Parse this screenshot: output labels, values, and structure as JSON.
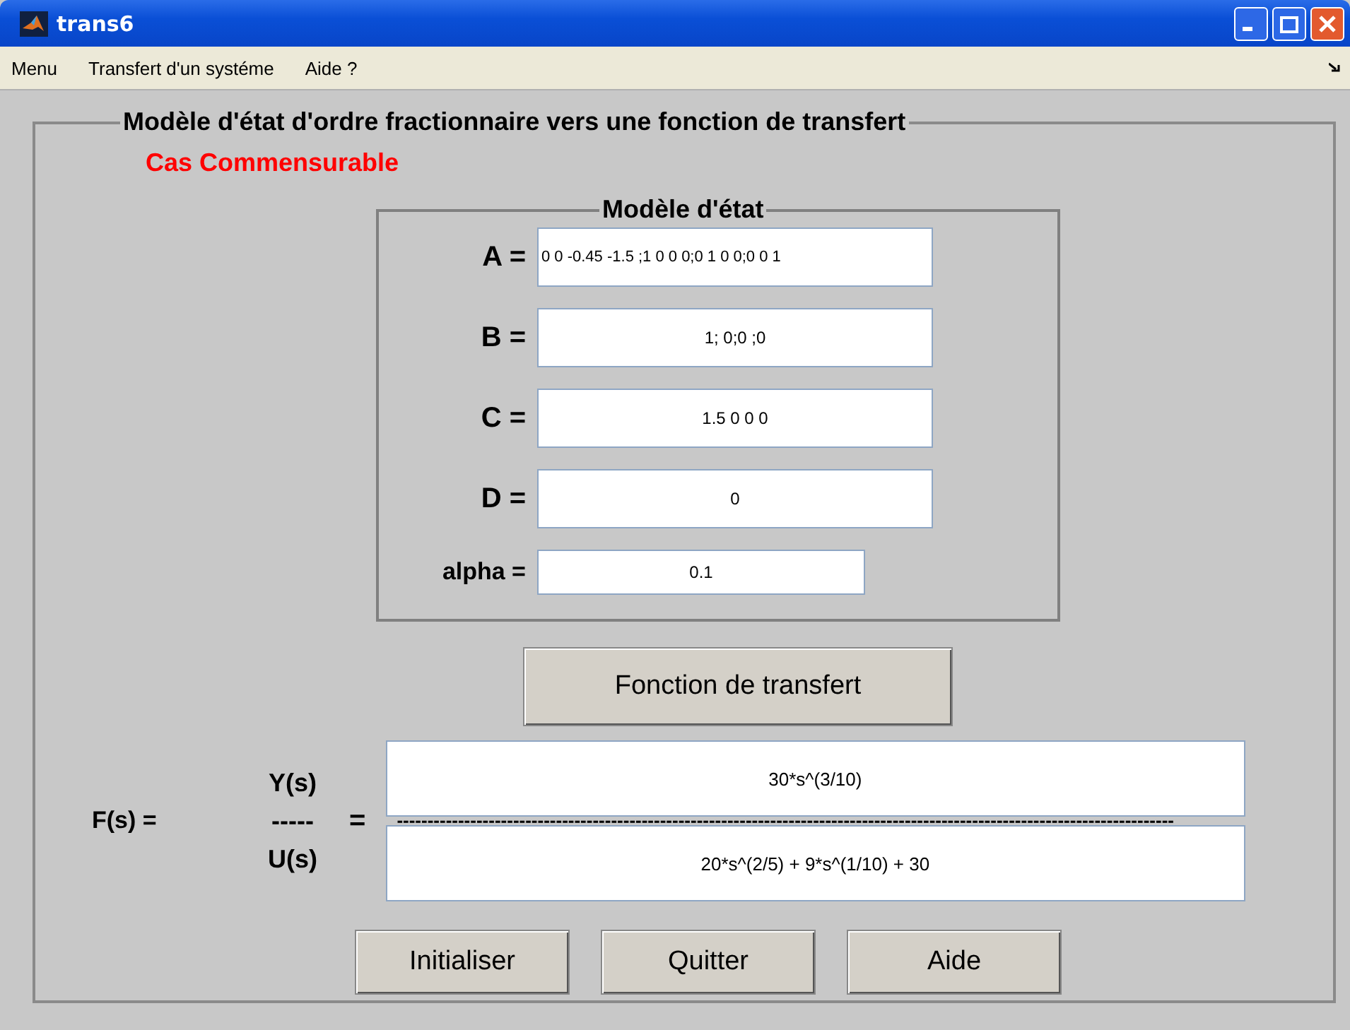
{
  "window": {
    "title": "trans6"
  },
  "menu": [
    "Menu",
    "Transfert d'un systéme",
    "Aide ?"
  ],
  "panel": {
    "title": "Modèle d'état d'ordre fractionnaire  vers une fonction de transfert",
    "case_label": "Cas  Commensurable"
  },
  "state_model": {
    "title": "Modèle d'état",
    "fields": [
      {
        "label": "A  =",
        "value": "0 0 -0.45 -1.5 ;1 0 0 0;0 1 0 0;0 0 1"
      },
      {
        "label": "B =",
        "value": "1; 0;0 ;0"
      },
      {
        "label": "C =",
        "value": "1.5 0 0 0"
      },
      {
        "label": "D =",
        "value": "0"
      },
      {
        "label": "alpha =",
        "value": "0.1"
      }
    ]
  },
  "compute_button": "Fonction de transfert",
  "transfer": {
    "label": "F(s) =",
    "numerator_label": "Y(s)",
    "bar_label": "-----",
    "equals": "=",
    "denominator_label": "U(s)",
    "numerator": "30*s^(3/10)",
    "fraction_bar": "-------------------------------------------------------------------------------------------------------------------------------",
    "denominator": "20*s^(2/5) + 9*s^(1/10) + 30"
  },
  "buttons": [
    "Initialiser",
    "Quitter",
    "Aide"
  ]
}
